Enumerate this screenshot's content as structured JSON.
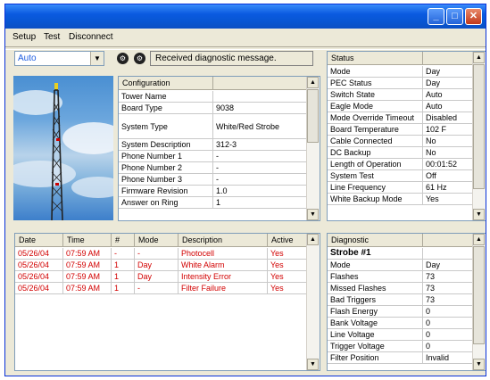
{
  "menu": [
    "Setup",
    "Test",
    "Disconnect"
  ],
  "mode_combo": {
    "value": "Auto"
  },
  "diagnostic_message": "Received diagnostic message.",
  "configuration": {
    "header": "Configuration",
    "rows": [
      {
        "label": "Tower Name",
        "value": ""
      },
      {
        "label": "Board Type",
        "value": "9038"
      },
      {
        "label": "System Type",
        "value": "White/Red Strobe"
      },
      {
        "label": "System Description",
        "value": "312-3"
      },
      {
        "label": "Phone Number 1",
        "value": "-"
      },
      {
        "label": "Phone Number 2",
        "value": "-"
      },
      {
        "label": "Phone Number 3",
        "value": "-"
      },
      {
        "label": "Firmware Revision",
        "value": "1.0"
      },
      {
        "label": "Answer on Ring",
        "value": "1"
      }
    ]
  },
  "status": {
    "header": "Status",
    "rows": [
      {
        "label": "Mode",
        "value": "Day"
      },
      {
        "label": "PEC Status",
        "value": "Day"
      },
      {
        "label": "Switch State",
        "value": "Auto"
      },
      {
        "label": "Eagle Mode",
        "value": "Auto"
      },
      {
        "label": "Mode Override Timeout",
        "value": "Disabled"
      },
      {
        "label": "Board Temperature",
        "value": "102 F"
      },
      {
        "label": "Cable Connected",
        "value": "No"
      },
      {
        "label": "DC Backup",
        "value": "No"
      },
      {
        "label": "Length of Operation",
        "value": "00:01:52"
      },
      {
        "label": "System Test",
        "value": "Off"
      },
      {
        "label": "Line Frequency",
        "value": "61 Hz"
      },
      {
        "label": "White Backup Mode",
        "value": "Yes"
      }
    ]
  },
  "alarms": {
    "headers": [
      "Date",
      "Time",
      "#",
      "Mode",
      "Description",
      "Active"
    ],
    "rows": [
      [
        "05/26/04",
        "07:59 AM",
        "-",
        "-",
        "Photocell",
        "Yes"
      ],
      [
        "05/26/04",
        "07:59 AM",
        "1",
        "Day",
        "White Alarm",
        "Yes"
      ],
      [
        "05/26/04",
        "07:59 AM",
        "1",
        "Day",
        "Intensity Error",
        "Yes"
      ],
      [
        "05/26/04",
        "07:59 AM",
        "1",
        "-",
        "Filter Failure",
        "Yes"
      ]
    ]
  },
  "diagnostic": {
    "header": "Diagnostic",
    "title": "Strobe #1",
    "rows": [
      {
        "label": "Mode",
        "value": "Day"
      },
      {
        "label": "Flashes",
        "value": "73"
      },
      {
        "label": "Missed Flashes",
        "value": "73"
      },
      {
        "label": "Bad Triggers",
        "value": "73"
      },
      {
        "label": "Flash Energy",
        "value": "0"
      },
      {
        "label": "Bank Voltage",
        "value": "0"
      },
      {
        "label": "Line Voltage",
        "value": "0"
      },
      {
        "label": "Trigger Voltage",
        "value": "0"
      },
      {
        "label": "Filter Position",
        "value": "Invalid"
      }
    ]
  }
}
